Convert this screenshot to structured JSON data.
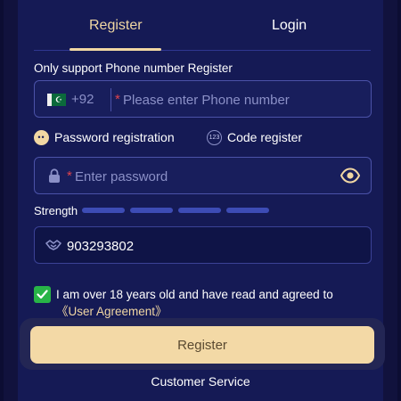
{
  "tabs": [
    {
      "label": "Register",
      "active": true
    },
    {
      "label": "Login",
      "active": false
    }
  ],
  "register_hint": "Only support Phone number Register",
  "phone": {
    "flag_icon": "pakistan-flag-icon",
    "dial_code": "+92",
    "required_mark": "*",
    "placeholder": "Please enter Phone number",
    "value": ""
  },
  "register_modes": [
    {
      "icon": "password-dots-icon",
      "label": "Password registration"
    },
    {
      "icon": "code-123-icon",
      "label": "Code register"
    }
  ],
  "password": {
    "required_mark": "*",
    "placeholder": "Enter password",
    "value": "",
    "toggle_icon": "eye-icon"
  },
  "strength": {
    "label": "Strength",
    "level": 0,
    "segments": 4
  },
  "invite_code": {
    "icon": "handshake-icon",
    "value": "903293802"
  },
  "agreement": {
    "checked": true,
    "text": "I am over 18 years old and have read and agreed to ",
    "link": "《User Agreement》"
  },
  "register_button": "Register",
  "customer_service": "Customer Service",
  "colors": {
    "background": "#11123d",
    "panel": "#151a55",
    "accent_gold": "#f1d7a3",
    "button": "#f3d9a6",
    "checkbox_green": "#28b447",
    "required_red": "#e0434b",
    "strength_bar": "#3d4cb5"
  }
}
